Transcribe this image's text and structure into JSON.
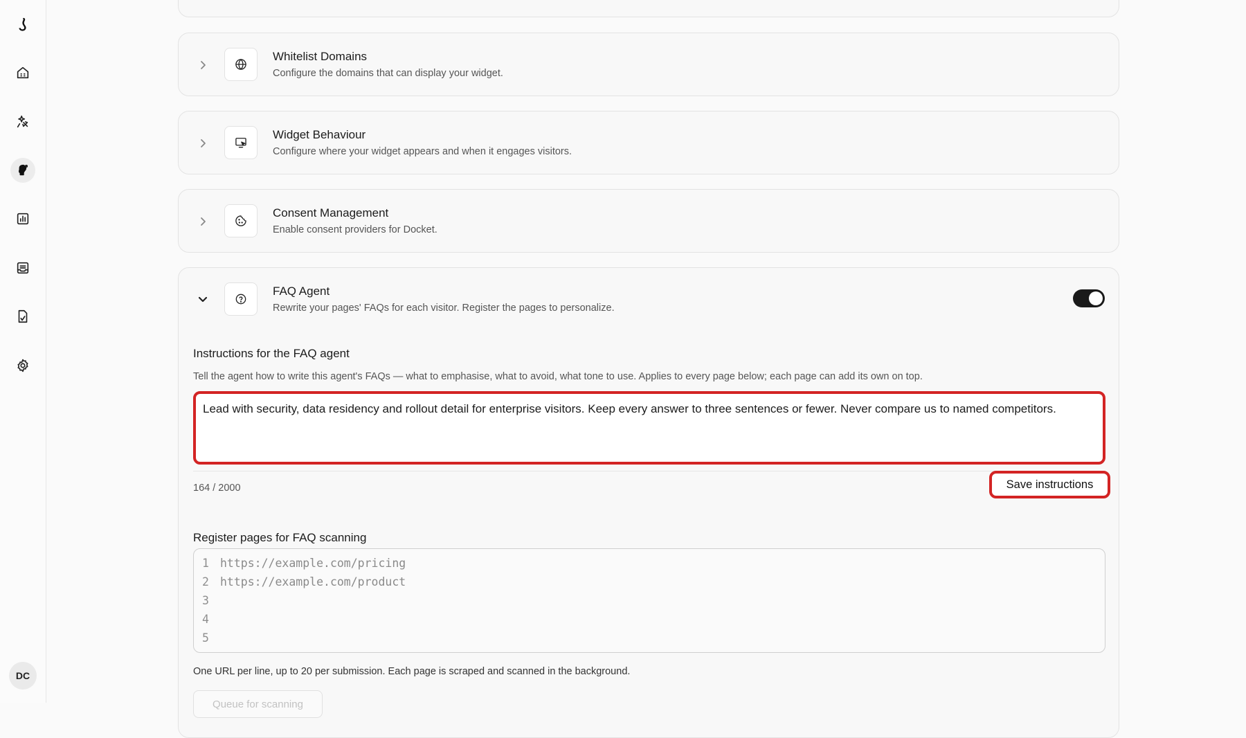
{
  "sidebar": {
    "items": [
      {
        "icon": "brand-logo-icon"
      },
      {
        "icon": "home-icon"
      },
      {
        "icon": "sparkle-rocket-icon"
      },
      {
        "icon": "agent-icon",
        "active": true
      },
      {
        "icon": "analytics-icon"
      },
      {
        "icon": "inbox-icon"
      },
      {
        "icon": "document-icon"
      },
      {
        "icon": "settings-icon"
      }
    ],
    "avatar_initials": "DC"
  },
  "cards": {
    "whitelist": {
      "title": "Whitelist Domains",
      "description": "Configure the domains that can display your widget.",
      "icon": "globe-icon"
    },
    "behaviour": {
      "title": "Widget Behaviour",
      "description": "Configure where your widget appears and when it engages visitors.",
      "icon": "monitor-cursor-icon"
    },
    "consent": {
      "title": "Consent Management",
      "description": "Enable consent providers for Docket.",
      "icon": "cookie-icon"
    },
    "faq": {
      "title": "FAQ Agent",
      "description": "Rewrite your pages' FAQs for each visitor. Register the pages to personalize.",
      "icon": "help-circle-icon",
      "enabled": true,
      "instructions": {
        "heading": "Instructions for the FAQ agent",
        "help": "Tell the agent how to write this agent's FAQs — what to emphasise, what to avoid, what tone to use. Applies to every page below; each page can add its own on top.",
        "value": "Lead with security, data residency and rollout detail for enterprise visitors. Keep every answer to three sentences or fewer. Never compare us to named competitors.",
        "counter": "164 / 2000",
        "save_label": "Save instructions"
      },
      "register": {
        "heading": "Register pages for FAQ scanning",
        "lines": [
          {
            "n": "1",
            "text": "https://example.com/pricing"
          },
          {
            "n": "2",
            "text": "https://example.com/product"
          },
          {
            "n": "3",
            "text": ""
          },
          {
            "n": "4",
            "text": ""
          },
          {
            "n": "5",
            "text": ""
          }
        ],
        "footnote": "One URL per line, up to 20 per submission. Each page is scraped and scanned in the background.",
        "queue_label": "Queue for scanning"
      }
    }
  },
  "colors": {
    "highlight": "#d32424",
    "toggle_on": "#1a1a1a"
  }
}
